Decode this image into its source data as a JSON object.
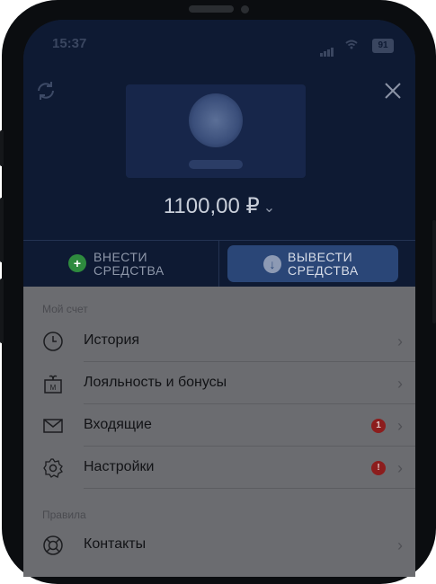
{
  "status_bar": {
    "time": "15:37",
    "battery": "91"
  },
  "header": {
    "balance": "1100,00 ₽"
  },
  "actions": {
    "deposit_line1": "ВНЕСТИ",
    "deposit_line2": "СРЕДСТВА",
    "withdraw_line1": "ВЫВЕСТИ",
    "withdraw_line2": "СРЕДСТВА"
  },
  "menu": {
    "section_account": "Мой счет",
    "history": "История",
    "loyalty": "Лояльность и бонусы",
    "inbox": "Входящие",
    "inbox_badge": "1",
    "settings": "Настройки",
    "settings_badge": "!",
    "section_rules": "Правила",
    "contacts": "Контакты"
  },
  "colors": {
    "header_bg": "#0e1a33",
    "accent_button": "#2a4677",
    "badge_red": "#8c1d1d",
    "deposit_green": "#2e8a3e"
  }
}
